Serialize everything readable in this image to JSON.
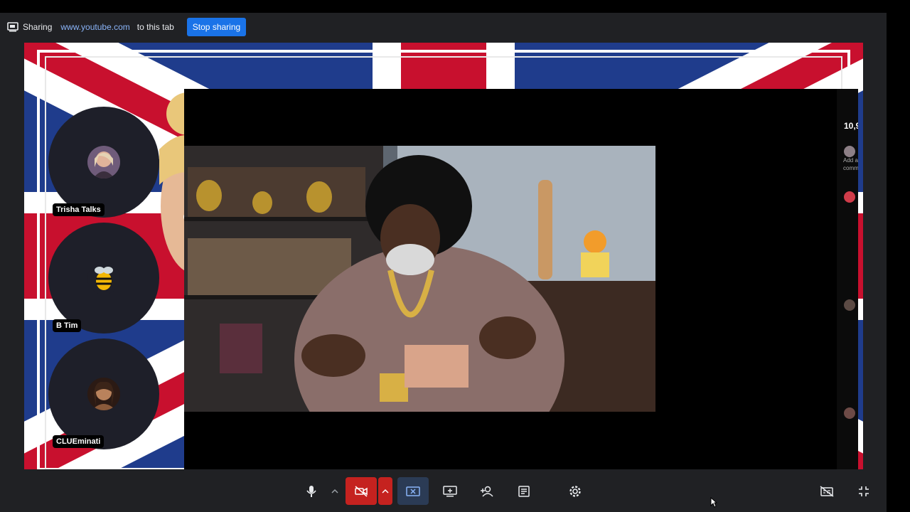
{
  "share_bar": {
    "sharing_label": "Sharing",
    "url": "www.youtube.com",
    "suffix": "to this tab",
    "stop_button": "Stop sharing"
  },
  "participants": [
    {
      "name": "Trisha Talks"
    },
    {
      "name": "B Tim"
    },
    {
      "name": "CLUEminati"
    }
  ],
  "chat_panel": {
    "count": "10,9",
    "add_comment": "Add a comm"
  },
  "controls": [
    {
      "icon": "mic-icon"
    },
    {
      "icon": "chevron-up-icon"
    },
    {
      "icon": "camera-off-icon"
    },
    {
      "icon": "chevron-up-icon"
    },
    {
      "icon": "stop-share-icon"
    },
    {
      "icon": "screen-share-icon"
    },
    {
      "icon": "add-person-icon"
    },
    {
      "icon": "notes-icon"
    },
    {
      "icon": "settings-icon"
    },
    {
      "icon": "captions-off-icon"
    },
    {
      "icon": "exit-fullscreen-icon"
    }
  ],
  "colors": {
    "accent": "#1a73e8",
    "danger": "#c5221f",
    "panel": "#202124",
    "link": "#8ab4f8"
  }
}
